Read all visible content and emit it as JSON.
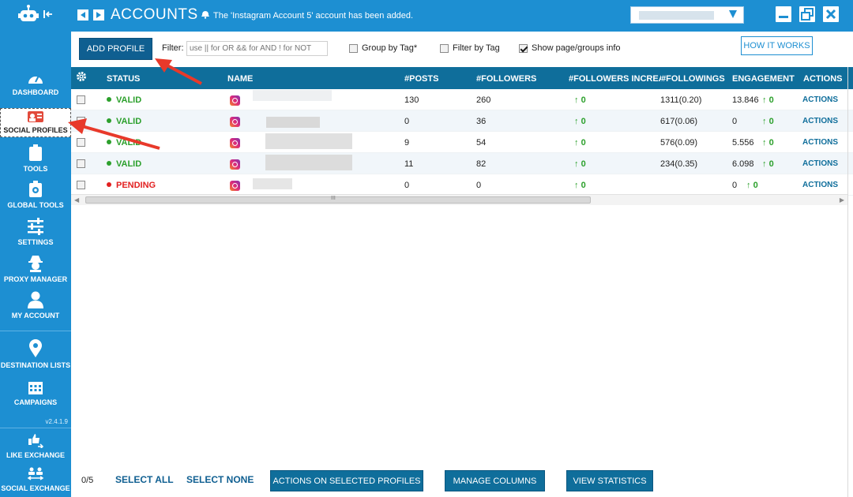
{
  "header": {
    "title": "ACCOUNTS",
    "notice": "The 'Instagram Account 5' account has been added."
  },
  "sidebar": {
    "items": [
      {
        "label": "DASHBOARD"
      },
      {
        "label": "SOCIAL PROFILES"
      },
      {
        "label": "TOOLS"
      },
      {
        "label": "GLOBAL TOOLS"
      },
      {
        "label": "SETTINGS"
      },
      {
        "label": "PROXY MANAGER"
      },
      {
        "label": "MY ACCOUNT"
      },
      {
        "label": "DESTINATION LISTS"
      },
      {
        "label": "CAMPAIGNS"
      },
      {
        "label": "LIKE EXCHANGE"
      },
      {
        "label": "SOCIAL EXCHANGE"
      }
    ],
    "version": "v2.4.1.9"
  },
  "toolbar": {
    "add_profile": "ADD PROFILE",
    "filter_label": "Filter:",
    "filter_placeholder": "use || for OR && for AND ! for NOT",
    "group_by_tag": "Group by Tag*",
    "filter_by_tag": "Filter by Tag",
    "show_info": "Show page/groups info",
    "how_it_works": "HOW IT WORKS"
  },
  "table": {
    "columns": [
      "STATUS",
      "NAME",
      "#POSTS",
      "#FOLLOWERS",
      "#FOLLOWERS INCREA",
      "#FOLLOWINGS",
      "ENGAGEMENT",
      "ACTIONS"
    ],
    "rows": [
      {
        "status": "VALID",
        "posts": "130",
        "followers": "260",
        "increase": "0",
        "followings": "1311(0.20)",
        "engagement": "13.846",
        "eng_increase": "0",
        "actions": "ACTIONS"
      },
      {
        "status": "VALID",
        "posts": "0",
        "followers": "36",
        "increase": "0",
        "followings": "617(0.06)",
        "engagement": "0",
        "eng_increase": "0",
        "actions": "ACTIONS"
      },
      {
        "status": "VALID",
        "posts": "9",
        "followers": "54",
        "increase": "0",
        "followings": "576(0.09)",
        "engagement": "5.556",
        "eng_increase": "0",
        "actions": "ACTIONS"
      },
      {
        "status": "VALID",
        "posts": "11",
        "followers": "82",
        "increase": "0",
        "followings": "234(0.35)",
        "engagement": "6.098",
        "eng_increase": "0",
        "actions": "ACTIONS"
      },
      {
        "status": "PENDING",
        "posts": "0",
        "followers": "0",
        "increase": "0",
        "followings": "",
        "engagement": "0",
        "eng_increase": "0",
        "actions": "ACTIONS"
      }
    ],
    "scroll_glyph": "III"
  },
  "footer": {
    "selected_count": "0/5",
    "select_all": "SELECT ALL",
    "select_none": "SELECT NONE",
    "actions_selected": "ACTIONS ON SELECTED PROFILES",
    "manage_columns": "MANAGE COLUMNS",
    "view_statistics": "VIEW STATISTICS"
  },
  "colors": {
    "accent": "#1d8fd2",
    "header_dark": "#0f6e9b",
    "valid": "#2ca02c",
    "pending": "#e22020",
    "annotation": "#e8392a"
  },
  "checkboxes": {
    "group_by_tag": false,
    "filter_by_tag": false,
    "show_info": true
  }
}
